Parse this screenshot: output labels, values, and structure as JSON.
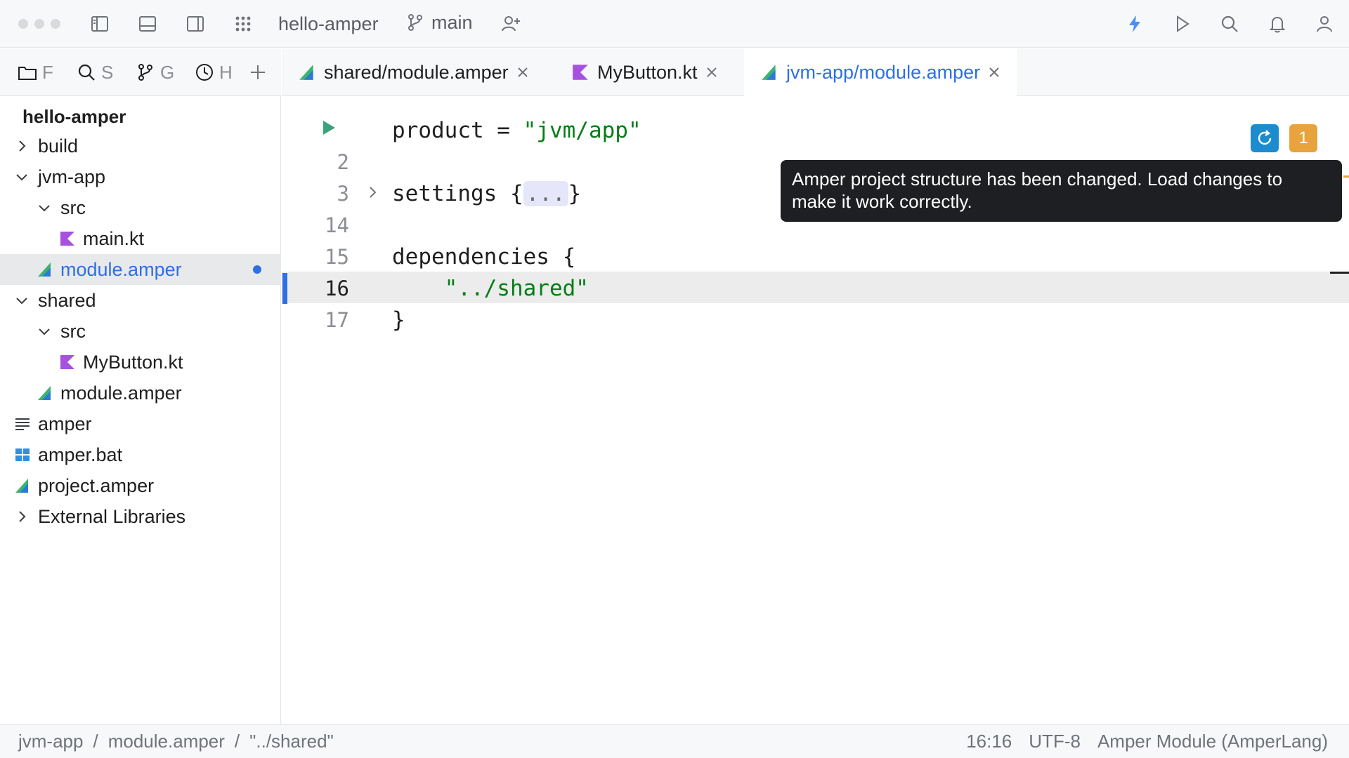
{
  "titlebar": {
    "project": "hello-amper",
    "branch": "main"
  },
  "tool_tabs": [
    {
      "label": "F",
      "icon": "folder-icon"
    },
    {
      "label": "S",
      "icon": "search-icon"
    },
    {
      "label": "G",
      "icon": "git-icon"
    },
    {
      "label": "H",
      "icon": "history-icon"
    }
  ],
  "sidebar": {
    "project_title": "hello-amper",
    "items": [
      {
        "label": "build",
        "indent": 0,
        "chevron": "right",
        "icon": ""
      },
      {
        "label": "jvm-app",
        "indent": 0,
        "chevron": "down",
        "icon": ""
      },
      {
        "label": "src",
        "indent": 1,
        "chevron": "down",
        "icon": ""
      },
      {
        "label": "main.kt",
        "indent": 2,
        "chevron": "",
        "icon": "kotlin-icon"
      },
      {
        "label": "module.amper",
        "indent": 1,
        "chevron": "",
        "icon": "amper-icon",
        "selected": true,
        "modified": true
      },
      {
        "label": "shared",
        "indent": 0,
        "chevron": "down",
        "icon": ""
      },
      {
        "label": "src",
        "indent": 1,
        "chevron": "down",
        "icon": ""
      },
      {
        "label": "MyButton.kt",
        "indent": 2,
        "chevron": "",
        "icon": "kotlin-icon"
      },
      {
        "label": "module.amper",
        "indent": 1,
        "chevron": "",
        "icon": "amper-icon"
      },
      {
        "label": "amper",
        "indent": 0,
        "chevron": "",
        "icon": "text-file-icon"
      },
      {
        "label": "amper.bat",
        "indent": 0,
        "chevron": "",
        "icon": "windows-icon"
      },
      {
        "label": "project.amper",
        "indent": 0,
        "chevron": "",
        "icon": "amper-icon"
      },
      {
        "label": "External Libraries",
        "indent": 0,
        "chevron": "right",
        "icon": ""
      }
    ]
  },
  "editor_tabs": [
    {
      "label": "shared/module.amper",
      "icon": "amper-icon",
      "active": false
    },
    {
      "label": "MyButton.kt",
      "icon": "kotlin-icon",
      "active": false
    },
    {
      "label": "jvm-app/module.amper",
      "icon": "amper-icon",
      "active": true
    }
  ],
  "editor": {
    "line_numbers": [
      "2",
      "3",
      "14",
      "15",
      "16",
      "17"
    ],
    "line1_key": "product = ",
    "line1_value": "\"jvm/app\"",
    "line3_text": "settings {",
    "line3_fold": "...",
    "line3_close": "}",
    "line15_text": "dependencies {",
    "line16_value": "    \"../shared\"",
    "line17_text": "}"
  },
  "notification": {
    "tooltip": "Amper project structure has been changed. Load changes to make it work correctly.",
    "warning_count": "1"
  },
  "statusbar": {
    "breadcrumb": [
      "jvm-app",
      "module.amper",
      "\"../shared\""
    ],
    "separator": "/",
    "position": "16:16",
    "encoding": "UTF-8",
    "file_type": "Amper Module (AmperLang)"
  },
  "colors": {
    "accent": "#2f6fe4",
    "string": "#067d17",
    "kotlin": "#a651e0",
    "amper_green": "#3cb371",
    "warning": "#e8a33d",
    "reload": "#1c8ccf",
    "run": "#3ba37a"
  }
}
